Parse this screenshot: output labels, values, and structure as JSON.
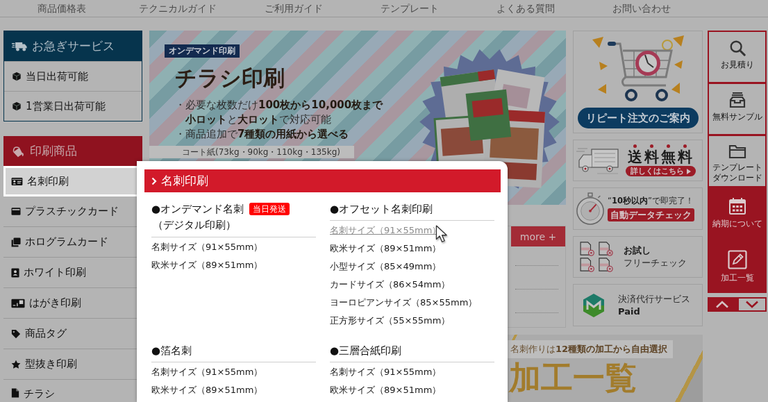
{
  "nav": {
    "links": [
      "商品価格表",
      "テクニカルガイド",
      "ご利用ガイド",
      "テンプレート",
      "よくある質問",
      "お問い合わせ"
    ]
  },
  "sidebar": {
    "groups": [
      {
        "kind": "express",
        "title": "お急ぎサービス",
        "items": [
          {
            "label": "当日出荷可能",
            "selected": false
          },
          {
            "label": "1営業日出荷可能",
            "selected": false
          }
        ]
      },
      {
        "kind": "products",
        "title": "印刷商品",
        "items": [
          {
            "label": "名刺印刷",
            "selected": true
          },
          {
            "label": "プラスチックカード",
            "selected": false
          },
          {
            "label": "ホログラムカード",
            "selected": false
          },
          {
            "label": "ホワイト印刷",
            "selected": false
          },
          {
            "label": "はがき印刷",
            "selected": false
          },
          {
            "label": "商品タグ",
            "selected": false
          },
          {
            "label": "型抜き印刷",
            "selected": false
          },
          {
            "label": "チラシ",
            "selected": false
          }
        ]
      }
    ]
  },
  "hero_banner": {
    "badge": "オンデマンド印刷",
    "title": "チラシ印刷",
    "points": [
      {
        "marker": "・",
        "lines": [
          "必要な枚数だけ**100枚から10,000枚まで**",
          "**小ロット**と**大ロット**で対応可能"
        ]
      },
      {
        "marker": "・",
        "lines": [
          "商品追加で**7種類の用紙から選べる**"
        ]
      }
    ],
    "note": "コート紙(73kg・90kg・110kg・135kg)"
  },
  "news": {
    "more_button": "more +"
  },
  "promo_banners": [
    {
      "kind": "repeat_order",
      "button": "リピート注文のご案内"
    },
    {
      "kind": "free_shipping",
      "title": "送料無料",
      "link": "詳しくはこちら"
    },
    {
      "kind": "data_check",
      "headline": "“**10秒以内**”で即完了！",
      "tag": "自動データチェック"
    },
    {
      "kind": "free_check",
      "title": "お試し",
      "subtitle": "フリーチェック"
    },
    {
      "kind": "payment",
      "title": "決済代行サービス",
      "subtitle": "Paid"
    }
  ],
  "bottom_banner": {
    "caption": "名刺作りは**12種類の加工から自由選択**",
    "title": "加工一覧"
  },
  "side_rail": {
    "items": [
      {
        "kind": "outlined",
        "label": "お見積り"
      },
      {
        "kind": "outlined",
        "label": "無料サンプル"
      },
      {
        "kind": "outlined",
        "label": "テンプレートダウンロード"
      },
      {
        "kind": "filled",
        "label": "納期について"
      },
      {
        "kind": "filled",
        "label": "加工一覧"
      }
    ]
  },
  "popup": {
    "title": "名刺印刷",
    "groups": [
      {
        "title": "●オンデマンド名刺",
        "badge": "当日発送",
        "subtitle": "（デジタル印刷）",
        "links": [
          {
            "label": "名刺サイズ（91×55mm）",
            "hover": false
          },
          {
            "label": "欧米サイズ（89×51mm）",
            "hover": false
          }
        ]
      },
      {
        "title": "●オフセット名刺印刷",
        "links": [
          {
            "label": "名刺サイズ（91×55mm）",
            "hover": true
          },
          {
            "label": "欧米サイズ（89×51mm）",
            "hover": false
          },
          {
            "label": "小型サイズ（85×49mm）",
            "hover": false
          },
          {
            "label": "カードサイズ（86×54mm）",
            "hover": false
          },
          {
            "label": "ヨーロピアンサイズ（85×55mm）",
            "hover": false
          },
          {
            "label": "正方形サイズ（55×55mm）",
            "hover": false
          }
        ]
      },
      {
        "title": "●箔名刺",
        "links": [
          {
            "label": "名刺サイズ（91×55mm）",
            "hover": false
          },
          {
            "label": "欧米サイズ（89×51mm）",
            "hover": false
          }
        ]
      },
      {
        "title": "●三層合紙印刷",
        "links": [
          {
            "label": "名刺サイズ（91×55mm）",
            "hover": false
          },
          {
            "label": "欧米サイズ（89×51mm）",
            "hover": false
          }
        ]
      }
    ]
  }
}
